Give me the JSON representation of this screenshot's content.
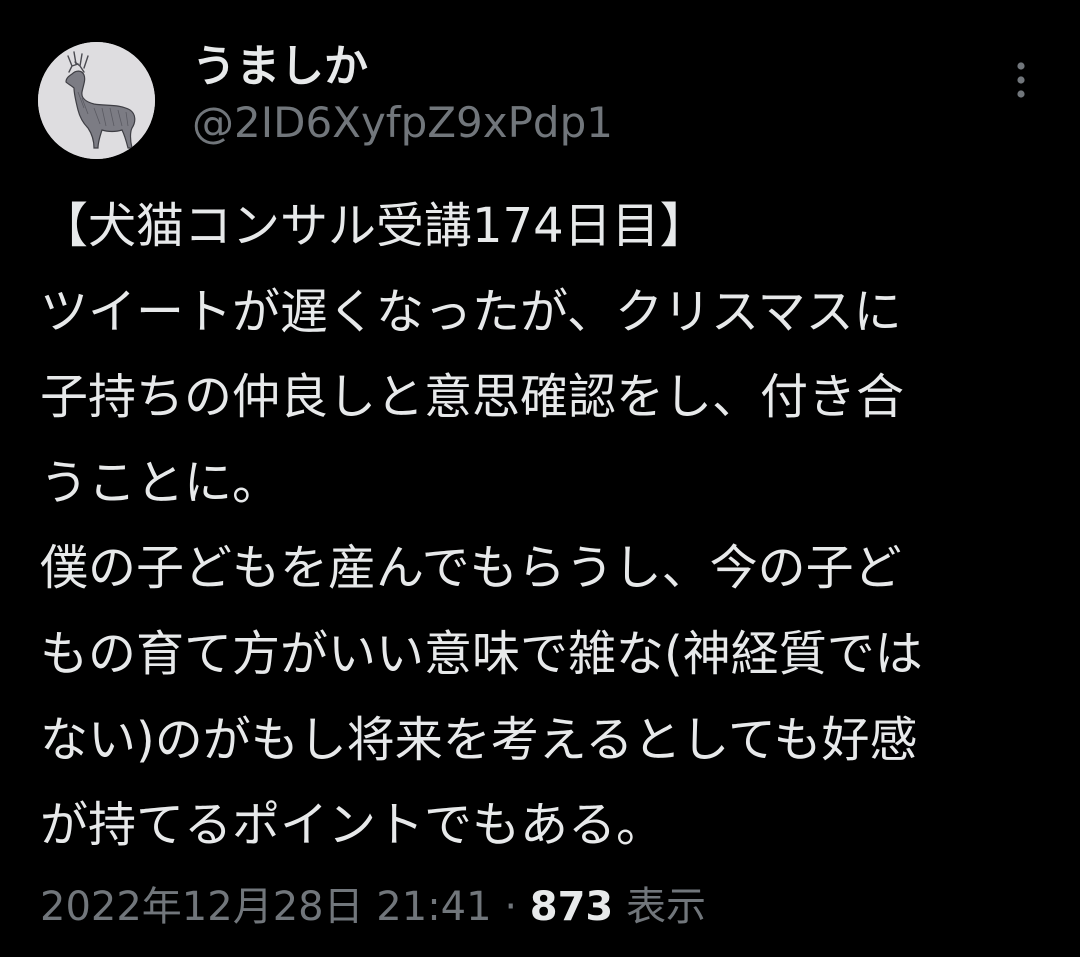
{
  "author": {
    "display_name": "うましか",
    "handle": "@2ID6XyfpZ9xPdp1",
    "avatar_icon": "deer-drawing-avatar"
  },
  "more_icon": "more-vertical-icon",
  "tweet": {
    "lines": [
      "【犬猫コンサル受講174日目】",
      "ツイートが遅くなったが、クリスマスに",
      "子持ちの仲良しと意思確認をし、付き合",
      "うことに。",
      "僕の子どもを産んでもらうし、今の子ど",
      "もの育て方がいい意味で雑な(神経質では",
      "ない)のがもし将来を考えるとしても好感",
      "が持てるポイントでもある。"
    ]
  },
  "meta": {
    "timestamp": "2022年12月28日 21:41",
    "separator": "·",
    "views_count": "873",
    "views_label": "表示"
  },
  "colors": {
    "background": "#000000",
    "primary_text": "#e7e9ea",
    "secondary_text": "#71767b"
  }
}
